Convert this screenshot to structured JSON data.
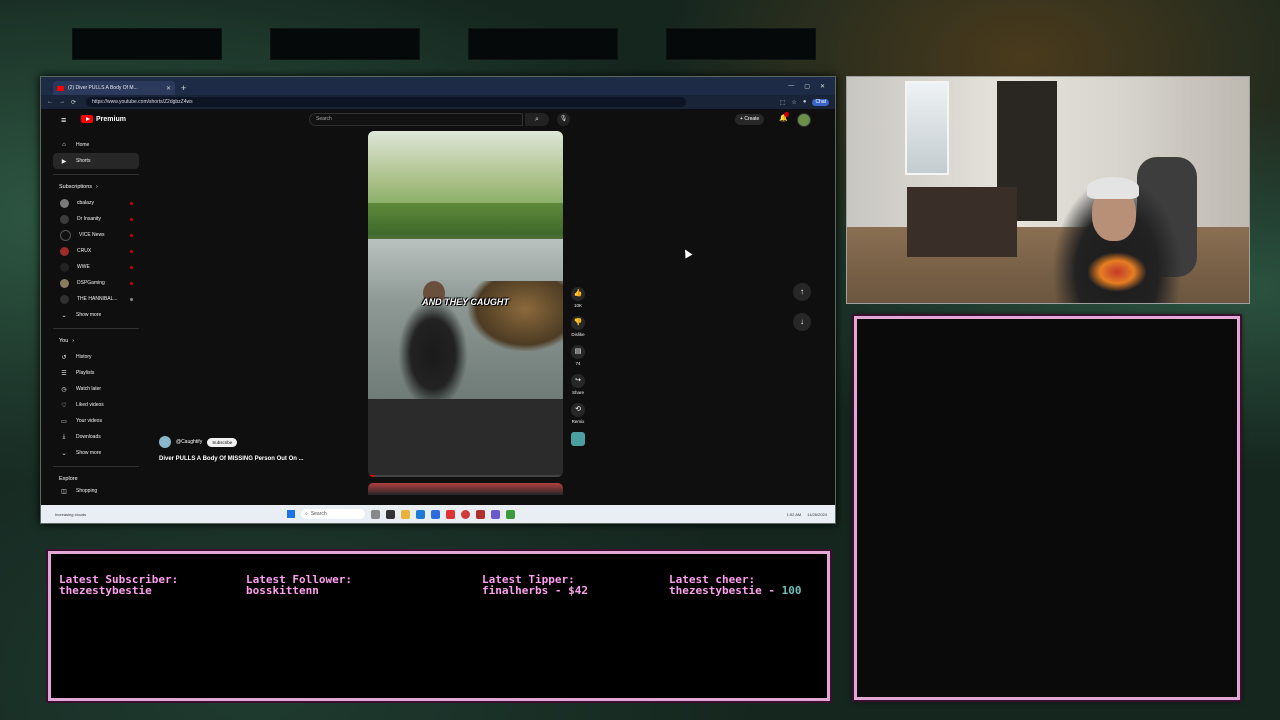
{
  "browser": {
    "tab_title": "(2) Diver PULLS A Body Of M...",
    "url": "https://www.youtube.com/shorts/Z2dgbzZ4ws",
    "chat_chip": "Chat",
    "nav": {
      "back": "←",
      "forward": "→",
      "refresh": "⟳"
    },
    "window_controls": [
      "—",
      "▢",
      "✕"
    ]
  },
  "youtube": {
    "logo_text": "Premium",
    "search_placeholder": "Search",
    "create_label": "Create",
    "sidebar": {
      "main": [
        {
          "label": "Home",
          "icon": "home-icon"
        },
        {
          "label": "Shorts",
          "icon": "shorts-icon"
        }
      ],
      "subscriptions_header": "Subscriptions",
      "channels": [
        "cbalazy",
        "Dr Insanity",
        "VICE News",
        "CRUX",
        "WWE",
        "DSPGaming",
        "THE HANNIBAL..."
      ],
      "show_more_1": "Show more",
      "you_header": "You",
      "you_items": [
        {
          "label": "History",
          "icon": "history-icon"
        },
        {
          "label": "Playlists",
          "icon": "playlists-icon"
        },
        {
          "label": "Watch later",
          "icon": "watch-later-icon"
        },
        {
          "label": "Liked videos",
          "icon": "liked-icon"
        },
        {
          "label": "Your videos",
          "icon": "your-videos-icon"
        },
        {
          "label": "Downloads",
          "icon": "downloads-icon"
        }
      ],
      "show_more_2": "Show more",
      "explore_header": "Explore",
      "explore_first": "Shopping"
    },
    "short": {
      "caption": "AND THEY CAUGHT",
      "channel_handle": "@Caughtify",
      "subscribe_label": "Subscribe",
      "title": "Diver PULLS A Body Of MISSING Person Out On ...",
      "progress_fraction": 0.03
    },
    "actions": [
      {
        "icon": "like-icon",
        "label": "10K"
      },
      {
        "icon": "dislike-icon",
        "label": "Dislike"
      },
      {
        "icon": "comment-icon",
        "label": "74"
      },
      {
        "icon": "share-icon",
        "label": "Share"
      },
      {
        "icon": "remix-icon",
        "label": "Remix"
      }
    ]
  },
  "taskbar": {
    "weather": "Increasing clouds",
    "search_label": "Search",
    "clock": "1:52 AM",
    "date": "11/26/2024"
  },
  "alerts": {
    "subscriber_label": "Latest Subscriber:",
    "subscriber_value": "thezestybestie",
    "follower_label": "Latest Follower:",
    "follower_value": "bosskittenn",
    "tipper_label": "Latest Tipper:",
    "tipper_value": "finalherbs - $42",
    "cheer_label": "Latest cheer:",
    "cheer_value": "thezestybestie - ",
    "cheer_amount": "100"
  },
  "colors": {
    "overlay_border": "#e3a7d6",
    "alert_text": "#ff9ff0",
    "youtube_red": "#ff0000",
    "youtube_bg": "#0f0f0f"
  }
}
